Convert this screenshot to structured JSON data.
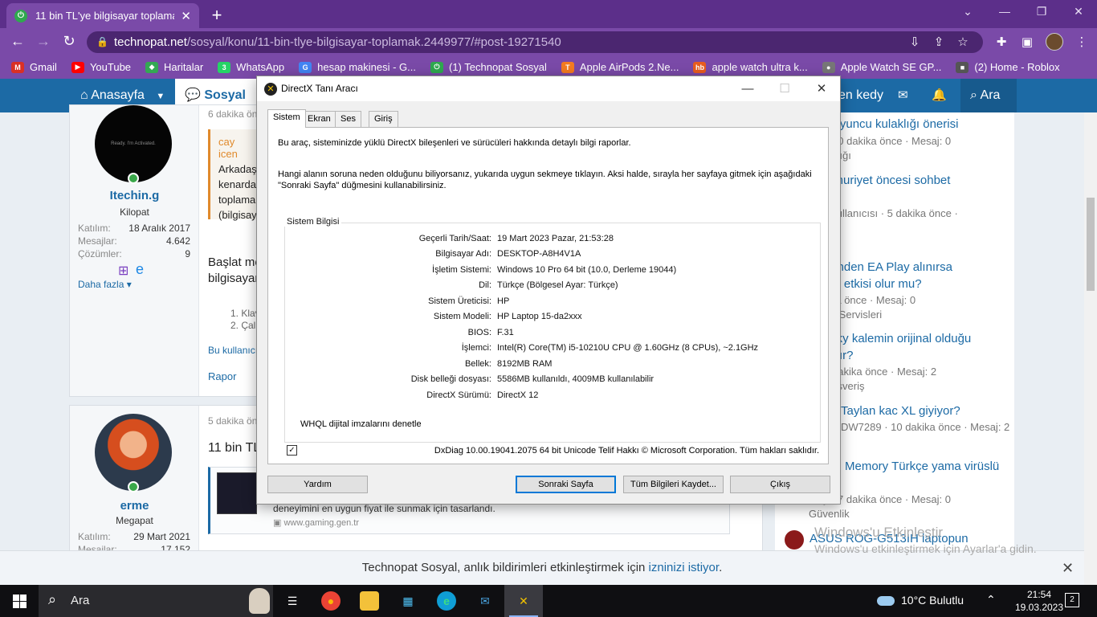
{
  "browser": {
    "tab_title": "11 bin TL'ye bilgisayar toplamak |",
    "url_host": "technopat.net",
    "url_path": "/sosyal/konu/11-bin-tlye-bilgisayar-toplamak.2449977/#post-19271540",
    "bookmarks": [
      {
        "label": "Gmail",
        "color": "#d93025",
        "glyph": "M"
      },
      {
        "label": "YouTube",
        "color": "#ff0000",
        "glyph": "▶"
      },
      {
        "label": "Haritalar",
        "color": "#34a853",
        "glyph": "◆"
      },
      {
        "label": "WhatsApp",
        "color": "#25d366",
        "glyph": "3"
      },
      {
        "label": "hesap makinesi - G...",
        "color": "#4285f4",
        "glyph": "G"
      },
      {
        "label": "(1) Technopat Sosyal",
        "color": "#2fa84f",
        "glyph": "⏻"
      },
      {
        "label": "Apple AirPods 2.Ne...",
        "color": "#f47b20",
        "glyph": "T"
      },
      {
        "label": "apple watch ultra k...",
        "color": "#e85d1f",
        "glyph": "hb"
      },
      {
        "label": "Apple Watch SE GP...",
        "color": "#777777",
        "glyph": "●"
      },
      {
        "label": "(2) Home - Roblox",
        "color": "#555555",
        "glyph": "■"
      }
    ]
  },
  "site": {
    "nav_home": "Anasayfa",
    "nav_social": "Sosyal",
    "nav_user": "en kedy",
    "nav_search": "Ara"
  },
  "post1": {
    "time": "6 dakika önce",
    "username": "Itechin.g",
    "rank": "Kilopat",
    "stats": [
      {
        "k": "Katılım:",
        "v": "18 Aralık 2017"
      },
      {
        "k": "Mesajlar:",
        "v": "4.642"
      },
      {
        "k": "Çözümler:",
        "v": "9"
      }
    ],
    "more": "Daha fazla",
    "quote_author": "cay icen",
    "quote_lines": [
      "Arkadaş",
      "kenarda",
      "toplama",
      "(bilgisay"
    ],
    "body_lines": [
      "Başlat me",
      "bilgisayar"
    ],
    "list_items": [
      "1. Klav",
      "2. Çalı"
    ],
    "footer": "Bu kullanıcı",
    "report": "Rapor"
  },
  "post2": {
    "time": "5 dakika önce",
    "username": "erme",
    "rank": "Megapat",
    "stats": [
      {
        "k": "Katılım:",
        "v": "29 Mart 2021"
      },
      {
        "k": "Mesajlar:",
        "v": "17.152"
      }
    ],
    "title": "11 bin TL",
    "embed_text": "deneyimini en uygun fiyat ile sunmak için tasarlandı.",
    "embed_url": "www.gaming.gen.tr"
  },
  "sidebar": {
    "items": [
      {
        "title": "suz oyuncu kulaklığı önerisi",
        "meta": "ge · 10 dakika önce · Mesaj: 0",
        "cat": "Kulaklığı"
      },
      {
        "title": "Cumhuriyet öncesi sohbet",
        "meta": "sky Kullanıcısı · 5 dakika önce ·",
        "cat": "0"
      },
      {
        "title": "üzerinden EA Play alınırsa",
        "title2": "maya etkisi olur mu?",
        "meta": "dakika önce · Mesaj: 0",
        "cat": "Oyun Servisleri"
      },
      {
        "title": "g Tikky kalemin orijinal olduğu",
        "title2": "nlaşılır?",
        "meta": ". · 8 dakika önce · Mesaj: 2",
        "cat": "en Alışveriş"
      },
      {
        "title": "Taylan kac XL giyiyor?",
        "meta": "DW7289 · 10 dakika önce · Mesaj: 2",
        "cat": ""
      },
      {
        "title": "Memory Türkçe yama virüslü",
        "meta": "y · 7 dakika önce · Mesaj: 0",
        "cat": "Güvenlik"
      },
      {
        "title": "ASUS ROG-G513IH laptopun",
        "meta": "",
        "cat": ""
      }
    ],
    "partial": [
      "at",
      "a"
    ]
  },
  "notification": {
    "text": "Technopat Sosyal, anlık bildirimleri etkinleştirmek için",
    "link": "izninizi istiyor",
    "tail": "."
  },
  "watermark": {
    "line1": "Windows'u Etkinleştir",
    "line2": "Windows'u etkinleştirmek için Ayarlar'a gidin."
  },
  "dxdiag": {
    "title": "DirectX Tanı Aracı",
    "tabs": [
      "Sistem",
      "Ekran",
      "Ses",
      "Giriş"
    ],
    "intro": "Bu araç, sisteminizde yüklü DirectX bileşenleri ve sürücüleri hakkında detaylı bilgi raporlar.",
    "help1": "Hangi alanın soruna neden olduğunu biliyorsanız, yukarıda uygun sekmeye tıklayın. Aksi halde, sırayla her sayfaya gitmek için aşağıdaki",
    "help2": "\"Sonraki Sayfa\" düğmesini kullanabilirsiniz.",
    "group_title": "Sistem Bilgisi",
    "rows": [
      {
        "k": "Geçerli Tarih/Saat:",
        "v": "19 Mart 2023 Pazar, 21:53:28"
      },
      {
        "k": "Bilgisayar Adı:",
        "v": "DESKTOP-A8H4V1A"
      },
      {
        "k": "İşletim Sistemi:",
        "v": "Windows 10 Pro 64 bit (10.0, Derleme 19044)"
      },
      {
        "k": "Dil:",
        "v": "Türkçe (Bölgesel Ayar: Türkçe)"
      },
      {
        "k": "Sistem Üreticisi:",
        "v": "HP"
      },
      {
        "k": "Sistem Modeli:",
        "v": "HP Laptop 15-da2xxx"
      },
      {
        "k": "BIOS:",
        "v": "F.31"
      },
      {
        "k": "İşlemci:",
        "v": "Intel(R) Core(TM) i5-10210U CPU @ 1.60GHz (8 CPUs), ~2.1GHz"
      },
      {
        "k": "Bellek:",
        "v": "8192MB RAM"
      },
      {
        "k": "Disk belleği dosyası:",
        "v": "5586MB kullanıldı, 4009MB kullanılabilir"
      },
      {
        "k": "DirectX Sürümü:",
        "v": "DirectX 12"
      }
    ],
    "whql_checked": true,
    "whql_label": "WHQL dijital imzalarını denetle",
    "footer": "DxDiag 10.00.19041.2075 64 bit Unicode  Telif Hakkı © Microsoft Corporation. Tüm hakları saklıdır.",
    "btn_help": "Yardım",
    "btn_next": "Sonraki Sayfa",
    "btn_save": "Tüm Bilgileri Kaydet...",
    "btn_exit": "Çıkış"
  },
  "taskbar": {
    "search_text": "Ara",
    "weather": "10°C  Bulutlu",
    "time": "21:54",
    "date": "19.03.2023",
    "notif_count": "2"
  }
}
